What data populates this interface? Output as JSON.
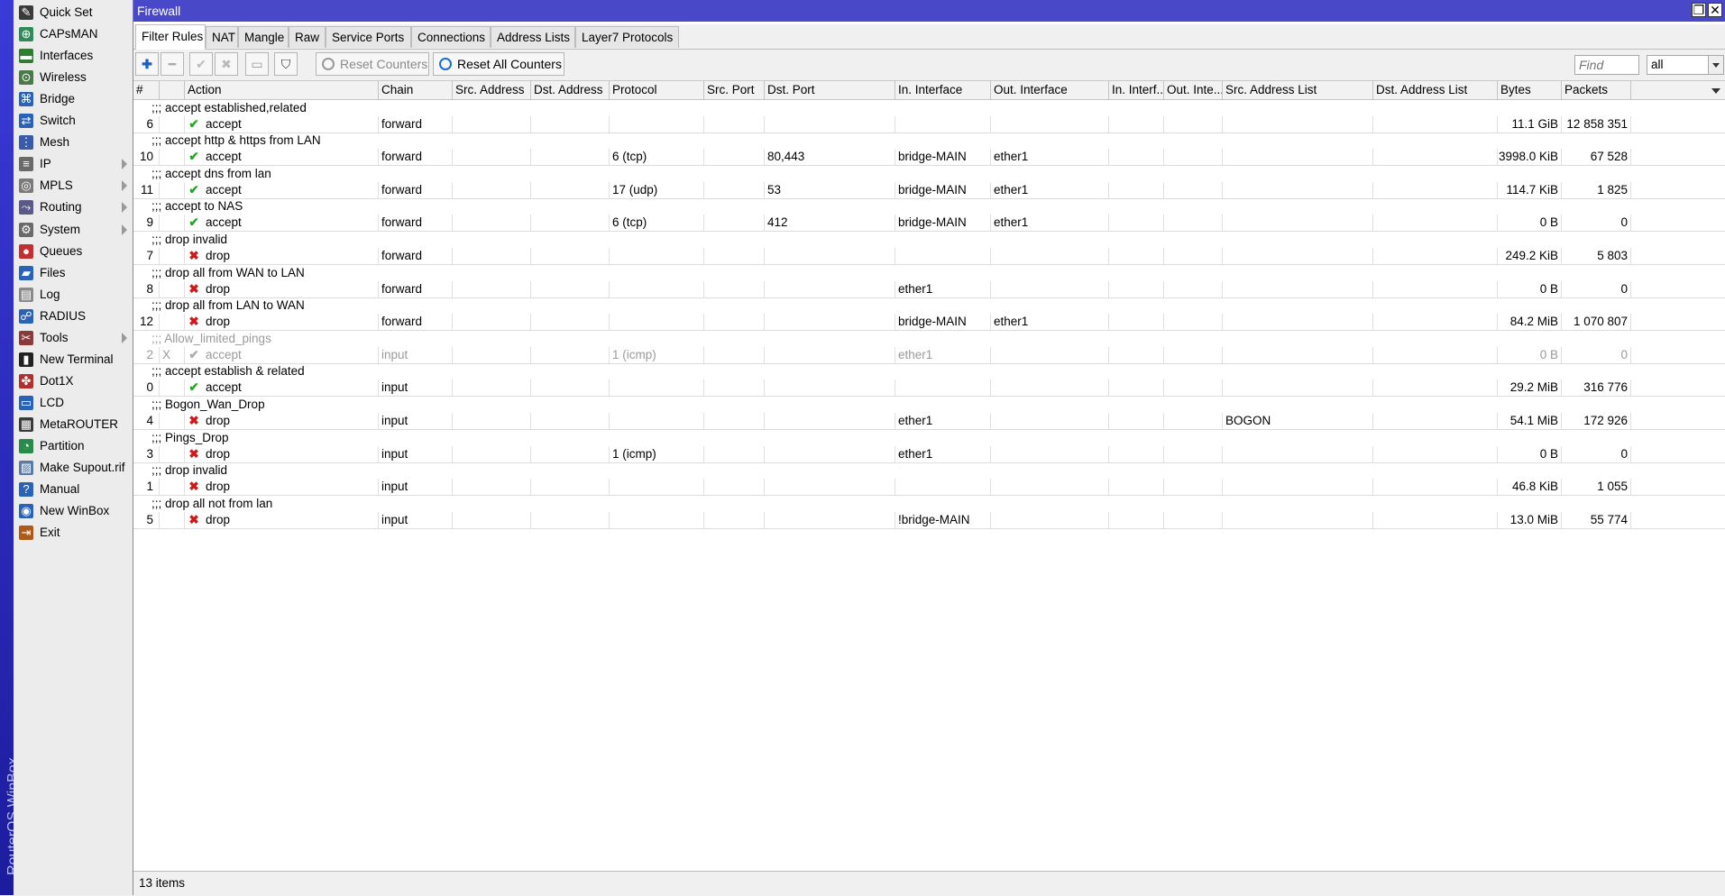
{
  "brand": "RouterOS WinBox",
  "menu": [
    {
      "label": "Quick Set",
      "icon": "quick-set-icon",
      "glyph": "✎",
      "color": "#3a3a3a",
      "sub": false
    },
    {
      "label": "CAPsMAN",
      "icon": "capsman-icon",
      "glyph": "⊕",
      "color": "#2e8b57",
      "sub": false
    },
    {
      "label": "Interfaces",
      "icon": "interfaces-icon",
      "glyph": "▬",
      "color": "#2f7d32",
      "sub": false
    },
    {
      "label": "Wireless",
      "icon": "wireless-icon",
      "glyph": "⊙",
      "color": "#4a7a4a",
      "sub": false
    },
    {
      "label": "Bridge",
      "icon": "bridge-icon",
      "glyph": "⌘",
      "color": "#2a62b5",
      "sub": false
    },
    {
      "label": "Switch",
      "icon": "switch-icon",
      "glyph": "⇄",
      "color": "#2a62b5",
      "sub": false
    },
    {
      "label": "Mesh",
      "icon": "mesh-icon",
      "glyph": "⋮",
      "color": "#3b5ba8",
      "sub": false
    },
    {
      "label": "IP",
      "icon": "ip-icon",
      "glyph": "≡",
      "color": "#6a6a6a",
      "sub": true
    },
    {
      "label": "MPLS",
      "icon": "mpls-icon",
      "glyph": "◎",
      "color": "#7a7a7a",
      "sub": true
    },
    {
      "label": "Routing",
      "icon": "routing-icon",
      "glyph": "⤳",
      "color": "#5a5a8a",
      "sub": true
    },
    {
      "label": "System",
      "icon": "system-icon",
      "glyph": "⚙",
      "color": "#6a6a6a",
      "sub": true
    },
    {
      "label": "Queues",
      "icon": "queues-icon",
      "glyph": "●",
      "color": "#c03030",
      "sub": false
    },
    {
      "label": "Files",
      "icon": "files-icon",
      "glyph": "▰",
      "color": "#2a62b5",
      "sub": false
    },
    {
      "label": "Log",
      "icon": "log-icon",
      "glyph": "▤",
      "color": "#8a8a8a",
      "sub": false
    },
    {
      "label": "RADIUS",
      "icon": "radius-icon",
      "glyph": "☍",
      "color": "#2a62b5",
      "sub": false
    },
    {
      "label": "Tools",
      "icon": "tools-icon",
      "glyph": "✂",
      "color": "#8a3a3a",
      "sub": true
    },
    {
      "label": "New Terminal",
      "icon": "terminal-icon",
      "glyph": "▮",
      "color": "#222222",
      "sub": false
    },
    {
      "label": "Dot1X",
      "icon": "dot1x-icon",
      "glyph": "✤",
      "color": "#b03030",
      "sub": false
    },
    {
      "label": "LCD",
      "icon": "lcd-icon",
      "glyph": "▭",
      "color": "#2a62b5",
      "sub": false
    },
    {
      "label": "MetaROUTER",
      "icon": "metarouter-icon",
      "glyph": "▦",
      "color": "#3a3a3a",
      "sub": false
    },
    {
      "label": "Partition",
      "icon": "partition-icon",
      "glyph": "◔",
      "color": "#2a8a4a",
      "sub": false
    },
    {
      "label": "Make Supout.rif",
      "icon": "supout-icon",
      "glyph": "▨",
      "color": "#5a7aa8",
      "sub": false
    },
    {
      "label": "Manual",
      "icon": "manual-icon",
      "glyph": "?",
      "color": "#2a62b5",
      "sub": false
    },
    {
      "label": "New WinBox",
      "icon": "winbox-icon",
      "glyph": "◉",
      "color": "#2a62b5",
      "sub": false
    },
    {
      "label": "Exit",
      "icon": "exit-icon",
      "glyph": "⇥",
      "color": "#b05a1a",
      "sub": false
    }
  ],
  "window": {
    "title": "Firewall",
    "restore_glyph": "❐",
    "close_glyph": "✕"
  },
  "tabs": [
    "Filter Rules",
    "NAT",
    "Mangle",
    "Raw",
    "Service Ports",
    "Connections",
    "Address Lists",
    "Layer7 Protocols"
  ],
  "toolbar": {
    "add_glyph": "✚",
    "remove_glyph": "━",
    "enable_glyph": "✔",
    "disable_glyph": "✖",
    "comment_glyph": "▭",
    "filter_glyph": "⛉",
    "reset_counters": "Reset Counters",
    "reset_all_counters": "Reset All Counters",
    "find_placeholder": "Find",
    "scope": "all"
  },
  "columns": [
    "#",
    "",
    "Action",
    "Chain",
    "Src. Address",
    "Dst. Address",
    "Protocol",
    "Src. Port",
    "Dst. Port",
    "In. Interface",
    "Out. Interface",
    "In. Interf...",
    "Out. Inte...",
    "Src. Address List",
    "Dst. Address List",
    "Bytes",
    "Packets"
  ],
  "rules": [
    {
      "comment": ";;; accept established,related",
      "num": "6",
      "flag": "",
      "action": "accept",
      "chain": "forward",
      "protocol": "",
      "dst_port": "",
      "in_if": "",
      "out_if": "",
      "src_list": "",
      "bytes": "11.1 GiB",
      "packets": "12 858 351",
      "disabled": false
    },
    {
      "comment": ";;; accept http & https from LAN",
      "num": "10",
      "flag": "",
      "action": "accept",
      "chain": "forward",
      "protocol": "6 (tcp)",
      "dst_port": "80,443",
      "in_if": "bridge-MAIN",
      "out_if": "ether1",
      "src_list": "",
      "bytes": "3998.0 KiB",
      "packets": "67 528",
      "disabled": false
    },
    {
      "comment": ";;; accept dns from lan",
      "num": "11",
      "flag": "",
      "action": "accept",
      "chain": "forward",
      "protocol": "17 (udp)",
      "dst_port": "53",
      "in_if": "bridge-MAIN",
      "out_if": "ether1",
      "src_list": "",
      "bytes": "114.7 KiB",
      "packets": "1 825",
      "disabled": false
    },
    {
      "comment": ";;; accept to NAS",
      "num": "9",
      "flag": "",
      "action": "accept",
      "chain": "forward",
      "protocol": "6 (tcp)",
      "dst_port": "412",
      "in_if": "bridge-MAIN",
      "out_if": "ether1",
      "src_list": "",
      "bytes": "0 B",
      "packets": "0",
      "disabled": false
    },
    {
      "comment": ";;; drop invalid",
      "num": "7",
      "flag": "",
      "action": "drop",
      "chain": "forward",
      "protocol": "",
      "dst_port": "",
      "in_if": "",
      "out_if": "",
      "src_list": "",
      "bytes": "249.2 KiB",
      "packets": "5 803",
      "disabled": false
    },
    {
      "comment": ";;; drop all from WAN to LAN",
      "num": "8",
      "flag": "",
      "action": "drop",
      "chain": "forward",
      "protocol": "",
      "dst_port": "",
      "in_if": "ether1",
      "out_if": "",
      "src_list": "",
      "bytes": "0 B",
      "packets": "0",
      "disabled": false
    },
    {
      "comment": ";;; drop all from LAN to WAN",
      "num": "12",
      "flag": "",
      "action": "drop",
      "chain": "forward",
      "protocol": "",
      "dst_port": "",
      "in_if": "bridge-MAIN",
      "out_if": "ether1",
      "src_list": "",
      "bytes": "84.2 MiB",
      "packets": "1 070 807",
      "disabled": false
    },
    {
      "comment": ";;; Allow_limited_pings",
      "num": "2",
      "flag": "X",
      "action": "accept",
      "chain": "input",
      "protocol": "1 (icmp)",
      "dst_port": "",
      "in_if": "ether1",
      "out_if": "",
      "src_list": "",
      "bytes": "0 B",
      "packets": "0",
      "disabled": true
    },
    {
      "comment": ";;; accept establish & related",
      "num": "0",
      "flag": "",
      "action": "accept",
      "chain": "input",
      "protocol": "",
      "dst_port": "",
      "in_if": "",
      "out_if": "",
      "src_list": "",
      "bytes": "29.2 MiB",
      "packets": "316 776",
      "disabled": false
    },
    {
      "comment": ";;; Bogon_Wan_Drop",
      "num": "4",
      "flag": "",
      "action": "drop",
      "chain": "input",
      "protocol": "",
      "dst_port": "",
      "in_if": "ether1",
      "out_if": "",
      "src_list": "BOGON",
      "bytes": "54.1 MiB",
      "packets": "172 926",
      "disabled": false
    },
    {
      "comment": ";;; Pings_Drop",
      "num": "3",
      "flag": "",
      "action": "drop",
      "chain": "input",
      "protocol": "1 (icmp)",
      "dst_port": "",
      "in_if": "ether1",
      "out_if": "",
      "src_list": "",
      "bytes": "0 B",
      "packets": "0",
      "disabled": false
    },
    {
      "comment": ";;; drop invalid",
      "num": "1",
      "flag": "",
      "action": "drop",
      "chain": "input",
      "protocol": "",
      "dst_port": "",
      "in_if": "",
      "out_if": "",
      "src_list": "",
      "bytes": "46.8 KiB",
      "packets": "1 055",
      "disabled": false
    },
    {
      "comment": ";;; drop all not from lan",
      "num": "5",
      "flag": "",
      "action": "drop",
      "chain": "input",
      "protocol": "",
      "dst_port": "",
      "in_if": "!bridge-MAIN",
      "out_if": "",
      "src_list": "",
      "bytes": "13.0 MiB",
      "packets": "55 774",
      "disabled": false
    }
  ],
  "status": "13 items"
}
